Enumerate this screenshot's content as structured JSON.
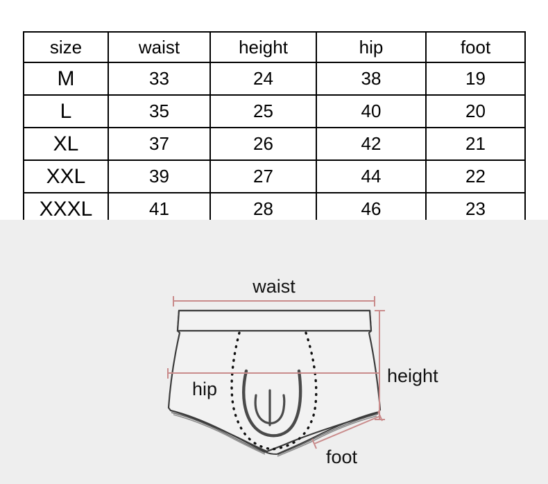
{
  "table": {
    "headers": [
      "size",
      "waist",
      "height",
      "hip",
      "foot"
    ],
    "rows": [
      {
        "size": "M",
        "waist": "33",
        "height": "24",
        "hip": "38",
        "foot": "19"
      },
      {
        "size": "L",
        "waist": "35",
        "height": "25",
        "hip": "40",
        "foot": "20"
      },
      {
        "size": "XL",
        "waist": "37",
        "height": "26",
        "hip": "42",
        "foot": "21"
      },
      {
        "size": "XXL",
        "waist": "39",
        "height": "27",
        "hip": "44",
        "foot": "22"
      },
      {
        "size": "XXXL",
        "waist": "41",
        "height": "28",
        "hip": "46",
        "foot": "23"
      }
    ]
  },
  "diagram": {
    "labels": {
      "waist": "waist",
      "height": "height",
      "hip": "hip",
      "foot": "foot"
    },
    "colors": {
      "background": "#eeeeee",
      "measure_line": "#c98b8b",
      "garment_outline": "#3b3b3b",
      "seam_dotted": "#111111",
      "text": "#111111"
    }
  }
}
